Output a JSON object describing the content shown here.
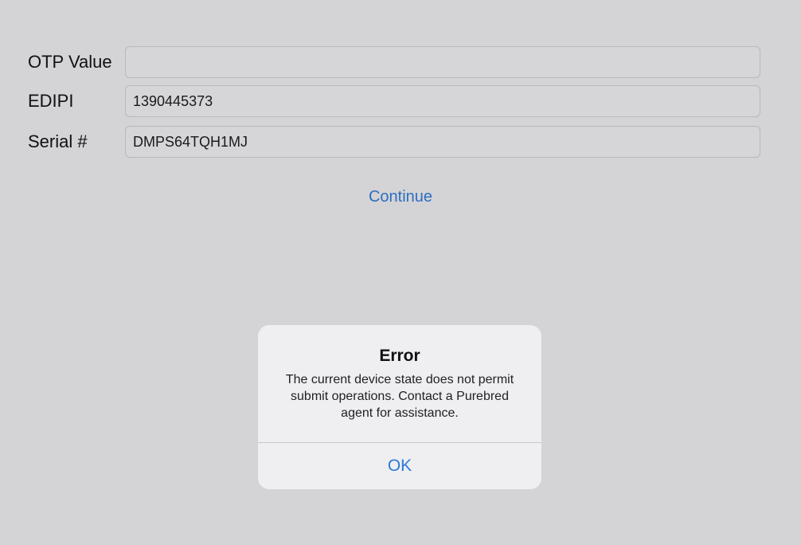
{
  "form": {
    "fields": [
      {
        "label": "OTP Value",
        "value": ""
      },
      {
        "label": "EDIPI",
        "value": "1390445373"
      },
      {
        "label": "Serial #",
        "value": "DMPS64TQH1MJ"
      }
    ],
    "continue_label": "Continue"
  },
  "alert": {
    "title": "Error",
    "message": "The current device state does not permit submit operations. Contact a Purebred agent for assistance.",
    "ok_label": "OK"
  },
  "colors": {
    "background": "#d4d3d6",
    "accent": "#2d7ad6",
    "dialog_background": "#efeef1"
  }
}
